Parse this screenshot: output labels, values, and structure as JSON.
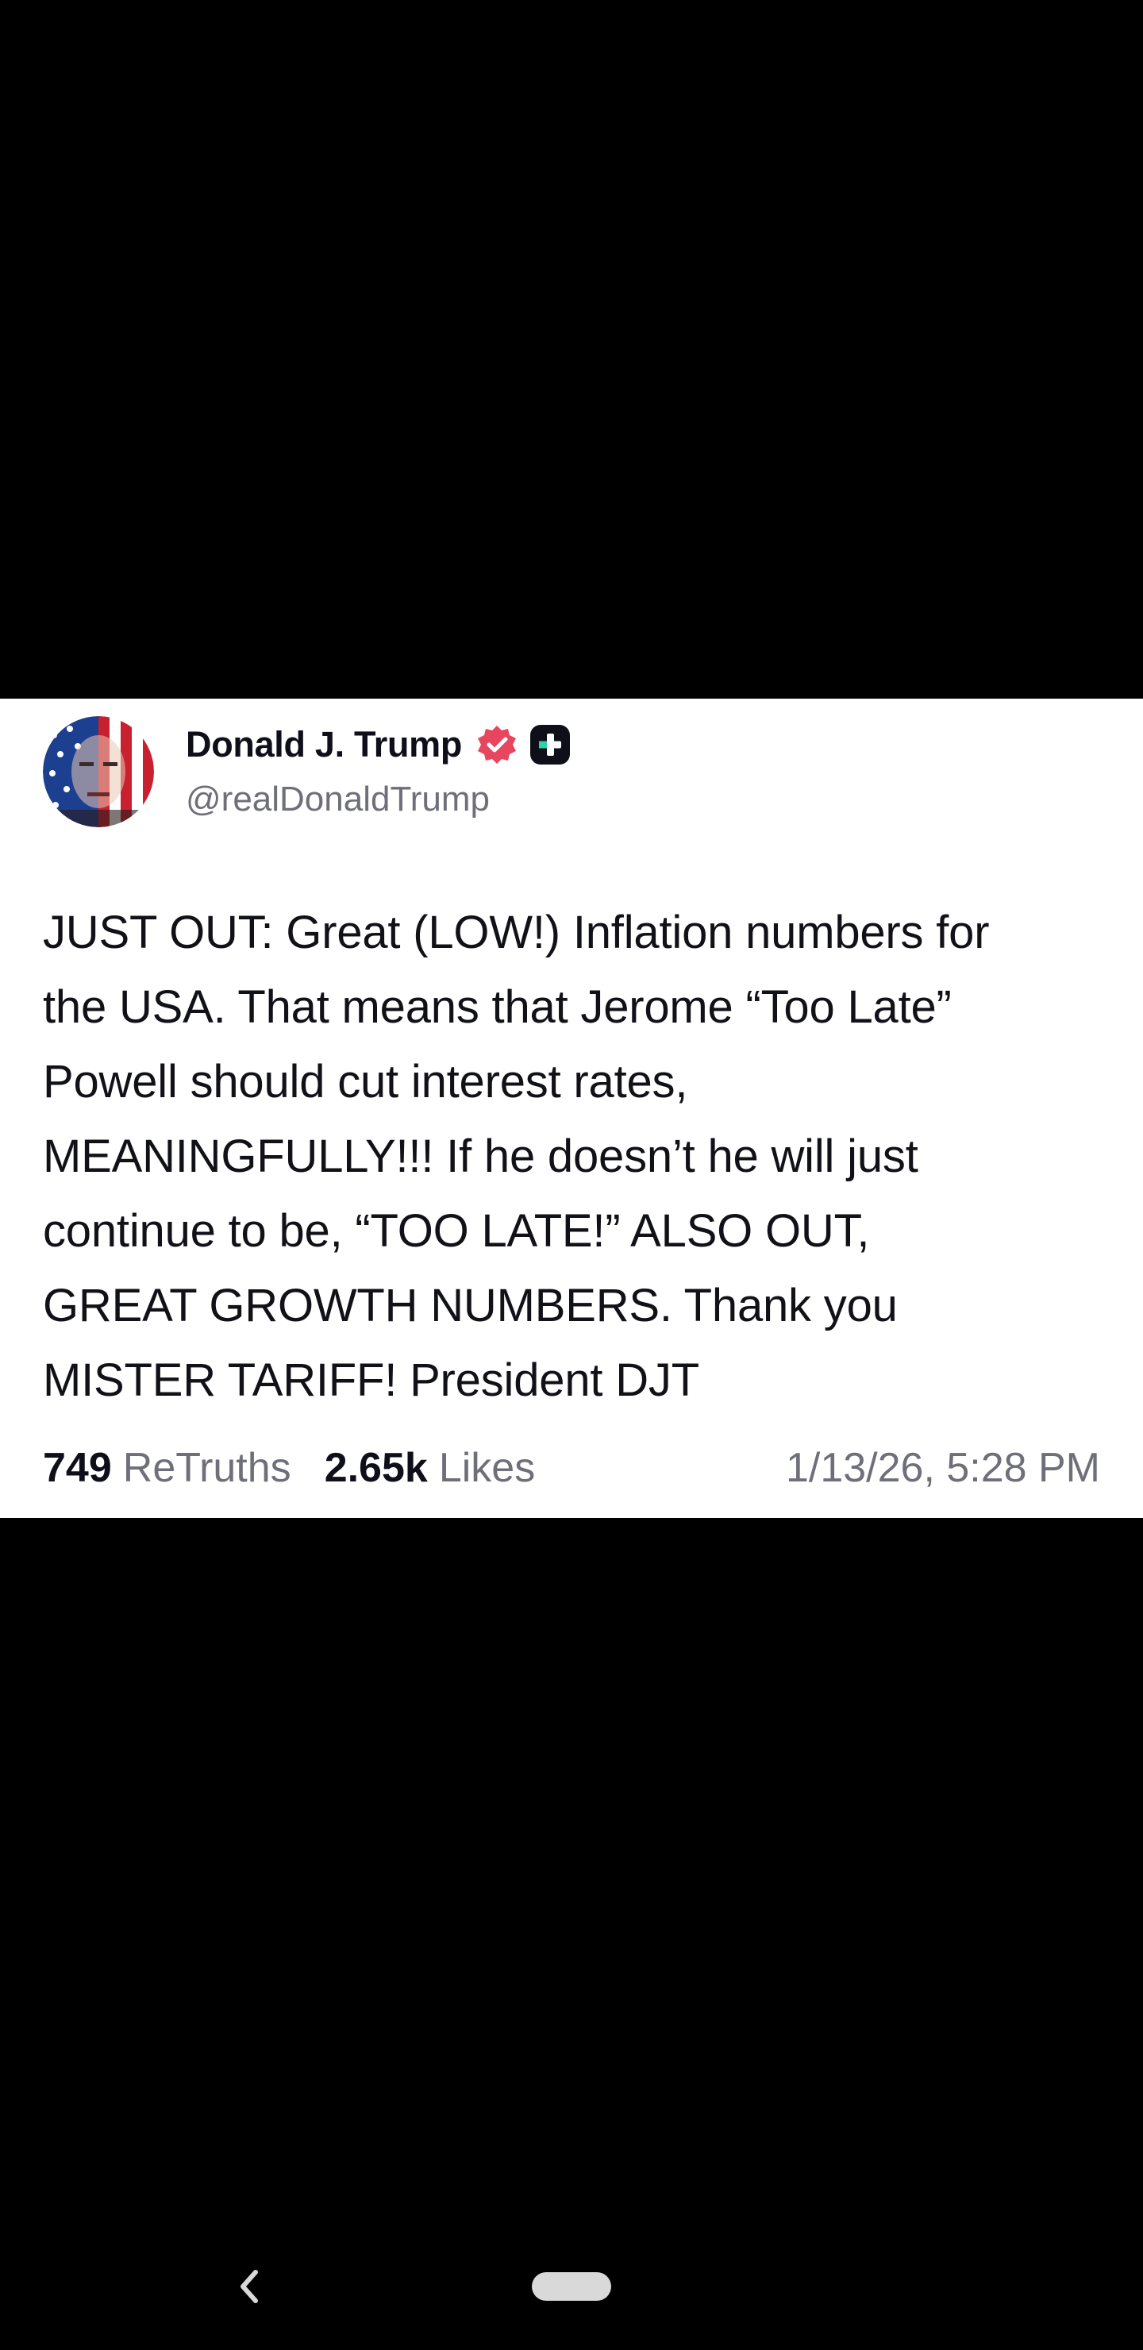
{
  "post": {
    "author": {
      "display_name": "Donald J. Trump",
      "handle": "@realDonaldTrump",
      "verified": true,
      "verified_color": "#e8455e",
      "badge_icon": "plus-badge-icon",
      "avatar_icon": "avatar"
    },
    "body": "JUST OUT: Great (LOW!) Inflation numbers for\nthe USA. That means that Jerome “Too Late”\nPowell should cut interest rates,\nMEANINGFULLY!!! If he doesn’t he will just\ncontinue to be, “TOO LATE!” ALSO OUT,\nGREAT GROWTH NUMBERS. Thank you\nMISTER TARIFF! President DJT",
    "stats": {
      "retruths_count": "749",
      "retruths_label": "ReTruths",
      "likes_count": "2.65k",
      "likes_label": "Likes"
    },
    "timestamp": "1/13/26, 5:28 PM"
  },
  "nav": {
    "back_icon": "back-icon",
    "home_icon": "home-pill"
  },
  "colors": {
    "background": "#000000",
    "card": "#ffffff",
    "text_primary": "#111118",
    "text_secondary": "#6f6f7a"
  }
}
